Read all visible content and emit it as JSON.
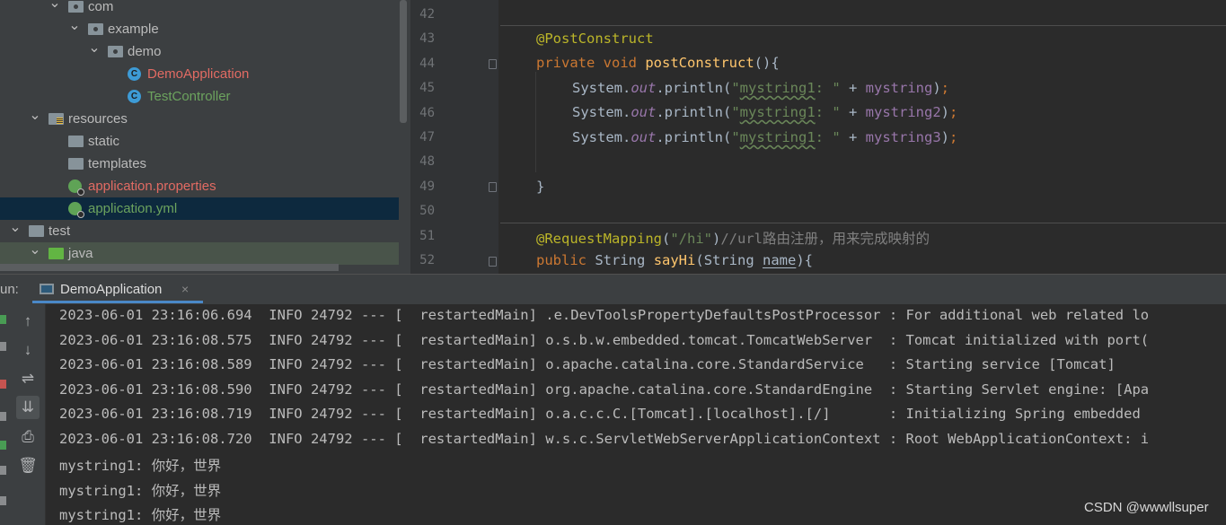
{
  "project_tree": {
    "items": [
      {
        "label": "com",
        "level": 4,
        "expanded": true,
        "icon": "package-folder-icon",
        "color": "default"
      },
      {
        "label": "example",
        "level": 5,
        "expanded": true,
        "icon": "package-folder-icon",
        "color": "default"
      },
      {
        "label": "demo",
        "level": 6,
        "expanded": true,
        "icon": "package-folder-icon",
        "color": "default"
      },
      {
        "label": "DemoApplication",
        "level": 7,
        "icon": "spring-boot-class-icon",
        "color": "red"
      },
      {
        "label": "TestController",
        "level": 7,
        "icon": "class-icon",
        "color": "green"
      },
      {
        "label": "resources",
        "level": 3,
        "expanded": true,
        "icon": "resources-folder-icon",
        "color": "default"
      },
      {
        "label": "static",
        "level": 4,
        "icon": "folder-icon",
        "color": "default"
      },
      {
        "label": "templates",
        "level": 4,
        "icon": "folder-icon",
        "color": "default"
      },
      {
        "label": "application.properties",
        "level": 4,
        "icon": "spring-config-icon",
        "color": "red"
      },
      {
        "label": "application.yml",
        "level": 4,
        "icon": "spring-config-icon",
        "color": "green",
        "selected": true
      },
      {
        "label": "test",
        "level": 2,
        "expanded": true,
        "icon": "folder-icon",
        "color": "default"
      },
      {
        "label": "java",
        "level": 3,
        "expanded": true,
        "icon": "test-source-folder-icon",
        "color": "default",
        "highlighted": true
      }
    ]
  },
  "editor": {
    "line_numbers": [
      "42",
      "43",
      "44",
      "45",
      "46",
      "47",
      "48",
      "49",
      "50",
      "51",
      "52"
    ],
    "annotation_postconstruct": "@PostConstruct",
    "kw_private": "private",
    "kw_void": "void",
    "method_postconstruct": "postConstruct",
    "paren_open_brace": "(){",
    "system_prefix": "System.",
    "out_field": "out",
    "println_call": ".println(",
    "string_quote_open": "\"",
    "string_word": "mystring1",
    "string_rest": ": \"",
    "plus_op": " + ",
    "var_mystring": "mystring",
    "var_mystring2": "mystring2",
    "var_mystring3": "mystring3",
    "close_paren": ")",
    "semicolon": ";",
    "close_brace": "}",
    "annotation_requestmapping": "@RequestMapping",
    "rm_open": "(",
    "rm_path": "\"/hi\"",
    "rm_close": ")",
    "rm_comment": "//url路由注册，用来完成映射的",
    "kw_public": "public",
    "type_string": "String",
    "method_sayhi": "sayHi",
    "param_open": "(String ",
    "param_name": "name",
    "param_close": "){"
  },
  "run_panel": {
    "label": "un:",
    "tab_label": "DemoApplication",
    "tab_close": "×",
    "tools": [
      {
        "name": "scroll-up-icon",
        "glyph": "↑"
      },
      {
        "name": "scroll-down-icon",
        "glyph": "↓"
      },
      {
        "name": "soft-wrap-icon",
        "glyph": "⇌"
      },
      {
        "name": "scroll-to-end-icon",
        "glyph": "⇊"
      },
      {
        "name": "print-icon",
        "glyph": "⎙"
      },
      {
        "name": "clear-all-icon",
        "glyph": "🗑"
      }
    ],
    "console_lines": [
      "2023-06-01 23:16:06.694  INFO 24792 --- [  restartedMain] .e.DevToolsPropertyDefaultsPostProcessor : For additional web related lo",
      "2023-06-01 23:16:08.575  INFO 24792 --- [  restartedMain] o.s.b.w.embedded.tomcat.TomcatWebServer  : Tomcat initialized with port(",
      "2023-06-01 23:16:08.589  INFO 24792 --- [  restartedMain] o.apache.catalina.core.StandardService   : Starting service [Tomcat]",
      "2023-06-01 23:16:08.590  INFO 24792 --- [  restartedMain] org.apache.catalina.core.StandardEngine  : Starting Servlet engine: [Apa",
      "2023-06-01 23:16:08.719  INFO 24792 --- [  restartedMain] o.a.c.c.C.[Tomcat].[localhost].[/]       : Initializing Spring embedded",
      "2023-06-01 23:16:08.720  INFO 24792 --- [  restartedMain] w.s.c.ServletWebServerApplicationContext : Root WebApplicationContext: i",
      "mystring1: 你好，世界",
      "mystring1: 你好，世界",
      "mystring1: 你好，世界"
    ]
  },
  "watermark": "CSDN @wwwllsuper",
  "colors": {
    "tree_bg": "#3c3f41",
    "editor_bg": "#2b2b2b",
    "keyword": "#cc7832",
    "annotation": "#bbb529",
    "string": "#6a8759",
    "field": "#9876aa",
    "method": "#ffc66d",
    "selection": "#0d293e",
    "tab_accent": "#4a88c7"
  }
}
